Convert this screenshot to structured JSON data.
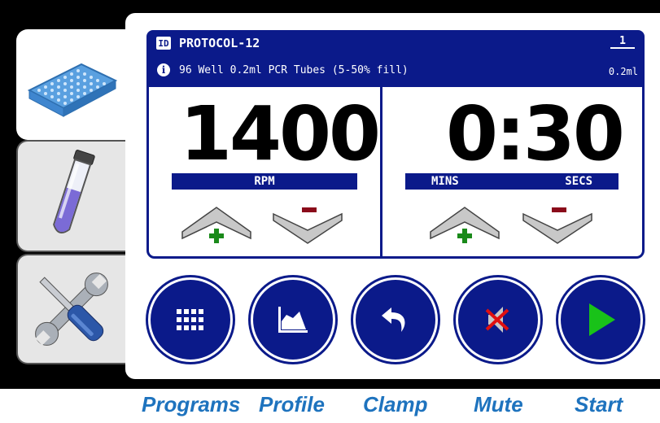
{
  "header": {
    "id_badge": "ID",
    "protocol_name": "PROTOCOL-12",
    "info_badge": "i",
    "description": "96 Well 0.2ml PCR Tubes (5-50% fill)",
    "tube_count": "1",
    "tube_volume": "0.2ml"
  },
  "speed": {
    "value": "1400",
    "unit": "RPM"
  },
  "time": {
    "value": "0:30",
    "min_label": "MINS",
    "sec_label": "SECS"
  },
  "buttons": [
    {
      "label": "Programs",
      "icon": "grid-icon"
    },
    {
      "label": "Profile",
      "icon": "profile-chart-icon"
    },
    {
      "label": "Clamp",
      "icon": "undo-arrow-icon"
    },
    {
      "label": "Mute",
      "icon": "mute-icon"
    },
    {
      "label": "Start",
      "icon": "play-icon"
    }
  ],
  "tabs": [
    {
      "name": "plate",
      "icon": "well-plate-icon",
      "active": true
    },
    {
      "name": "tube",
      "icon": "test-tube-icon",
      "active": false
    },
    {
      "name": "settings",
      "icon": "tools-icon",
      "active": false
    }
  ],
  "colors": {
    "accent": "#0b1a8a",
    "plus": "#1a8a1a",
    "minus": "#8a0b1a",
    "play": "#19c219",
    "label": "#1e73be"
  }
}
